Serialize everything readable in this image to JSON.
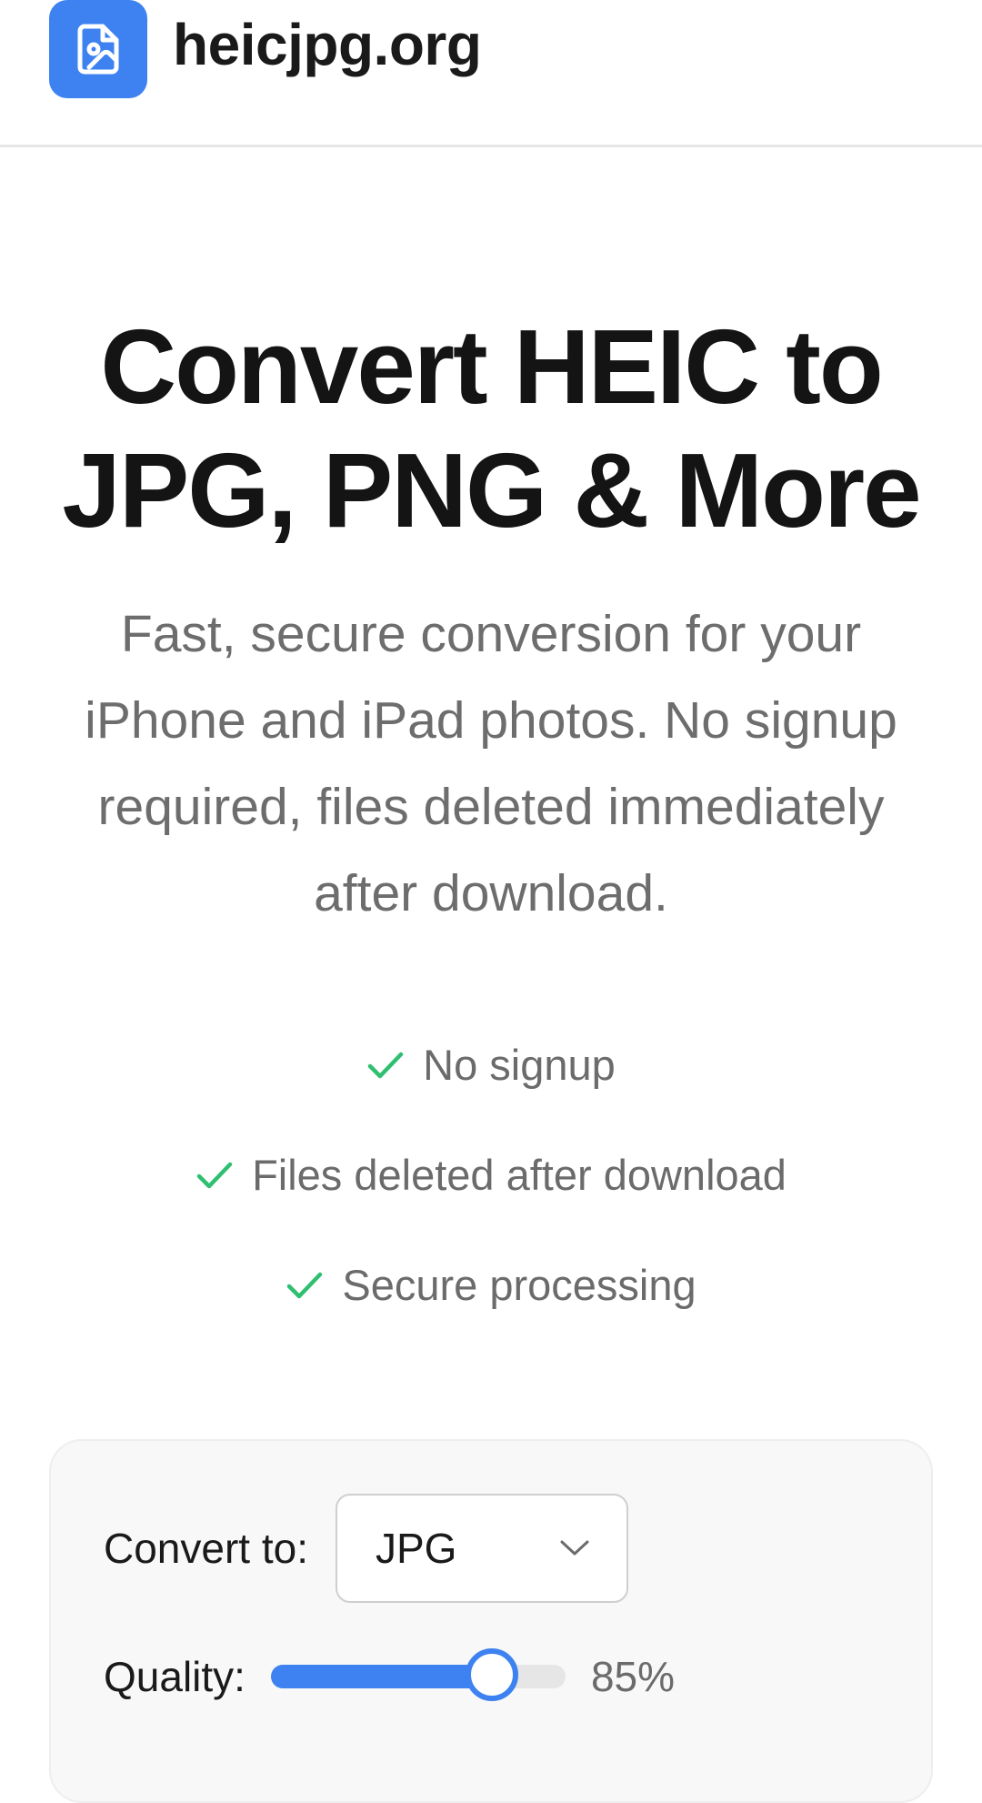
{
  "header": {
    "brand": "heicjpg.org",
    "logo_icon": "image-file-icon",
    "accent_color": "#3d82f0"
  },
  "hero": {
    "title_line1": "Convert HEIC to",
    "title_line2": "JPG, PNG & More",
    "subtitle": "Fast, secure conversion for your iPhone and iPad photos. No signup required, files deleted immediately after download."
  },
  "features": [
    {
      "label": "No signup",
      "icon": "check-icon"
    },
    {
      "label": "Files deleted after download",
      "icon": "check-icon"
    },
    {
      "label": "Secure processing",
      "icon": "check-icon"
    }
  ],
  "converter": {
    "convert_label": "Convert to:",
    "format_selected": "JPG",
    "quality_label": "Quality:",
    "quality_value": 85,
    "quality_display": "85%"
  },
  "colors": {
    "check": "#2fbf71",
    "slider_fill": "#3d82f0"
  }
}
